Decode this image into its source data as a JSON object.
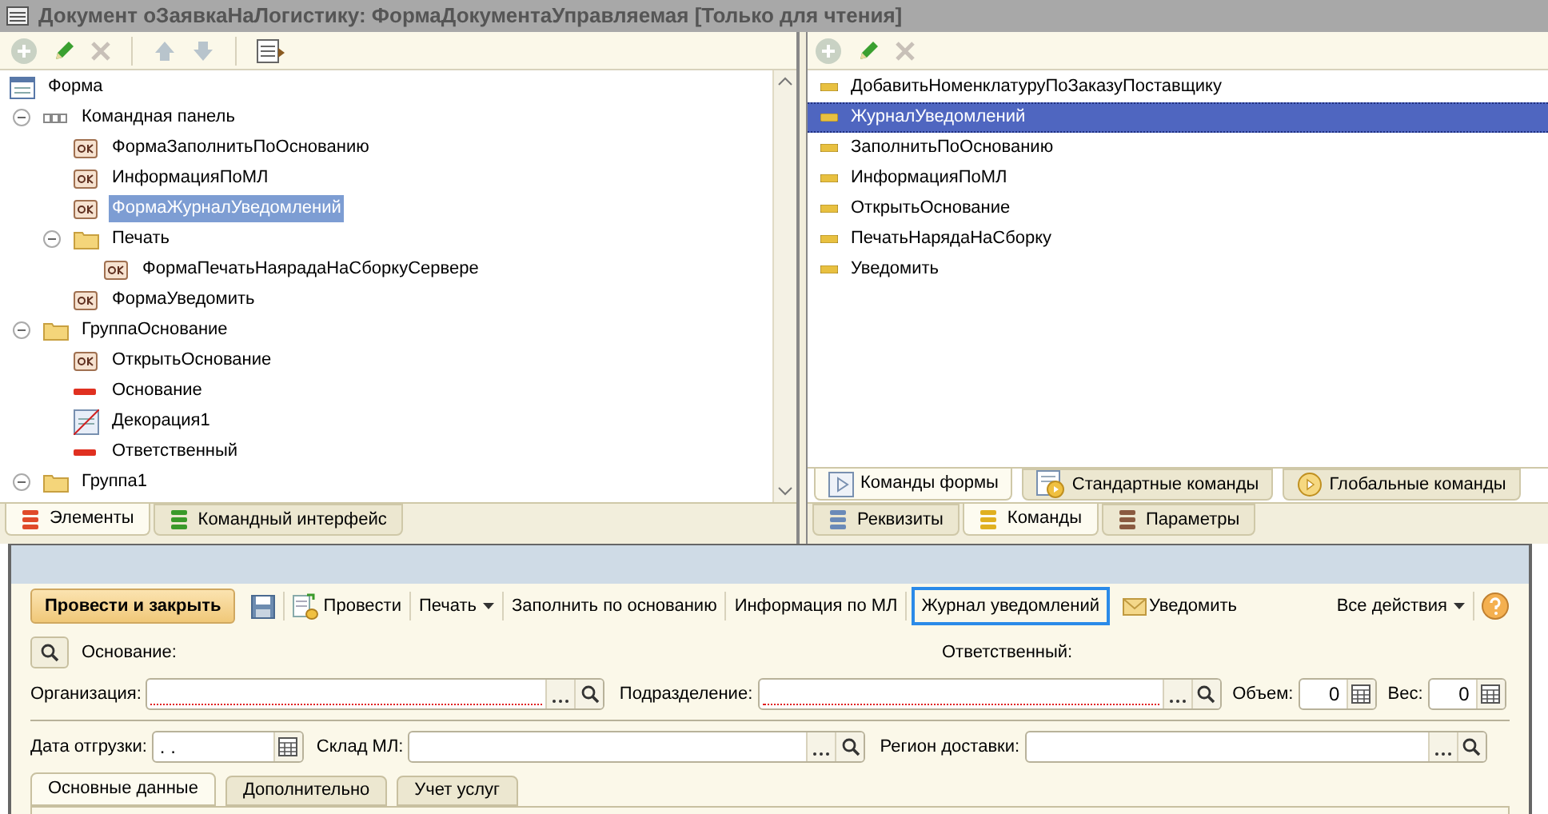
{
  "window": {
    "title": "Документ оЗаявкаНаЛогистику: ФормаДокументаУправляемая [Только для чтения]"
  },
  "elements_panel": {
    "toolbar": [
      {
        "kind": "add"
      },
      {
        "kind": "edit"
      },
      {
        "kind": "delete"
      },
      {
        "kind": "separator"
      },
      {
        "kind": "up"
      },
      {
        "kind": "down"
      },
      {
        "kind": "separator"
      },
      {
        "kind": "properties"
      }
    ],
    "tree": [
      {
        "label": "Форма",
        "kind": "form",
        "selected": false,
        "children": [
          {
            "label": "Командная панель",
            "kind": "command_bar",
            "selected": false,
            "expanded": true,
            "children": [
              {
                "label": "ФормаЗаполнитьПоОснованию",
                "kind": "button",
                "selected": false
              },
              {
                "label": "ИнформацияПоМЛ",
                "kind": "button",
                "selected": false
              },
              {
                "label": "ФормаЖурналУведомлений",
                "kind": "button",
                "selected": true
              },
              {
                "label": "Печать",
                "kind": "group",
                "selected": false,
                "expanded": true,
                "children": [
                  {
                    "label": "ФормаПечатьНаярадаНаСборкуСервере",
                    "kind": "button",
                    "selected": false
                  }
                ]
              },
              {
                "label": "ФормаУведомить",
                "kind": "button",
                "selected": false
              }
            ]
          },
          {
            "label": "ГруппаОснование",
            "kind": "group",
            "selected": false,
            "expanded": true,
            "children": [
              {
                "label": "ОткрытьОснование",
                "kind": "button",
                "selected": false
              },
              {
                "label": "Основание",
                "kind": "field",
                "selected": false
              },
              {
                "label": "Декорация1",
                "kind": "decoration",
                "selected": false
              },
              {
                "label": "Ответственный",
                "kind": "field",
                "selected": false
              }
            ]
          },
          {
            "label": "Группа1",
            "kind": "group",
            "selected": false,
            "expanded": true
          }
        ]
      }
    ],
    "tabs": [
      {
        "label": "Элементы",
        "selected": true,
        "color": "#e04a2a"
      },
      {
        "label": "Командный интерфейс",
        "selected": false,
        "color": "#3a9a2a"
      }
    ]
  },
  "commands_panel": {
    "toolbar": [
      {
        "kind": "add"
      },
      {
        "kind": "edit"
      },
      {
        "kind": "delete"
      }
    ],
    "items": [
      {
        "label": "ДобавитьНоменклатуруПоЗаказуПоставщику",
        "selected": false
      },
      {
        "label": "ЖурналУведомлений",
        "selected": true
      },
      {
        "label": "ЗаполнитьПоОснованию",
        "selected": false
      },
      {
        "label": "ИнформацияПоМЛ",
        "selected": false
      },
      {
        "label": "ОткрытьОснование",
        "selected": false
      },
      {
        "label": "ПечатьНарядаНаСборку",
        "selected": false
      },
      {
        "label": "Уведомить",
        "selected": false
      }
    ],
    "command_tabs": [
      {
        "label": "Команды формы",
        "selected": true,
        "kind": "form"
      },
      {
        "label": "Стандартные команды",
        "selected": false,
        "kind": "standard"
      },
      {
        "label": "Глобальные команды",
        "selected": false,
        "kind": "global"
      }
    ],
    "tabs": [
      {
        "label": "Реквизиты",
        "selected": false,
        "color": "#6a8ab8"
      },
      {
        "label": "Команды",
        "selected": true,
        "color": "#e0b020"
      },
      {
        "label": "Параметры",
        "selected": false,
        "color": "#8a5a40"
      }
    ]
  },
  "form": {
    "toolbar": [
      {
        "kind": "default",
        "label": "Провести и закрыть"
      },
      {
        "kind": "save"
      },
      {
        "kind": "icon_text",
        "label": "Провести"
      },
      {
        "kind": "menu",
        "label": "Печать"
      },
      {
        "kind": "text",
        "label": "Заполнить по основанию"
      },
      {
        "kind": "text",
        "label": "Информация по МЛ"
      },
      {
        "kind": "focused",
        "label": "Журнал уведомлений"
      },
      {
        "kind": "mail",
        "label": "Уведомить"
      },
      {
        "kind": "spacer"
      },
      {
        "kind": "menu",
        "label": "Все действия"
      },
      {
        "kind": "help"
      }
    ],
    "basis_label": "Основание:",
    "responsible_label": "Ответственный:",
    "organization": {
      "label": "Организация:"
    },
    "department": {
      "label": "Подразделение:"
    },
    "volume": {
      "label": "Объем:",
      "value": "0"
    },
    "weight": {
      "label": "Вес:",
      "value": "0"
    },
    "ship_date": {
      "label": "Дата отгрузки:",
      "value": " .  ."
    },
    "warehouse": {
      "label": "Склад МЛ:"
    },
    "region": {
      "label": "Регион доставки:"
    },
    "tabs": [
      {
        "label": "Основные данные",
        "selected": true
      },
      {
        "label": "Дополнительно",
        "selected": false
      },
      {
        "label": "Учет услуг",
        "selected": false
      }
    ]
  }
}
